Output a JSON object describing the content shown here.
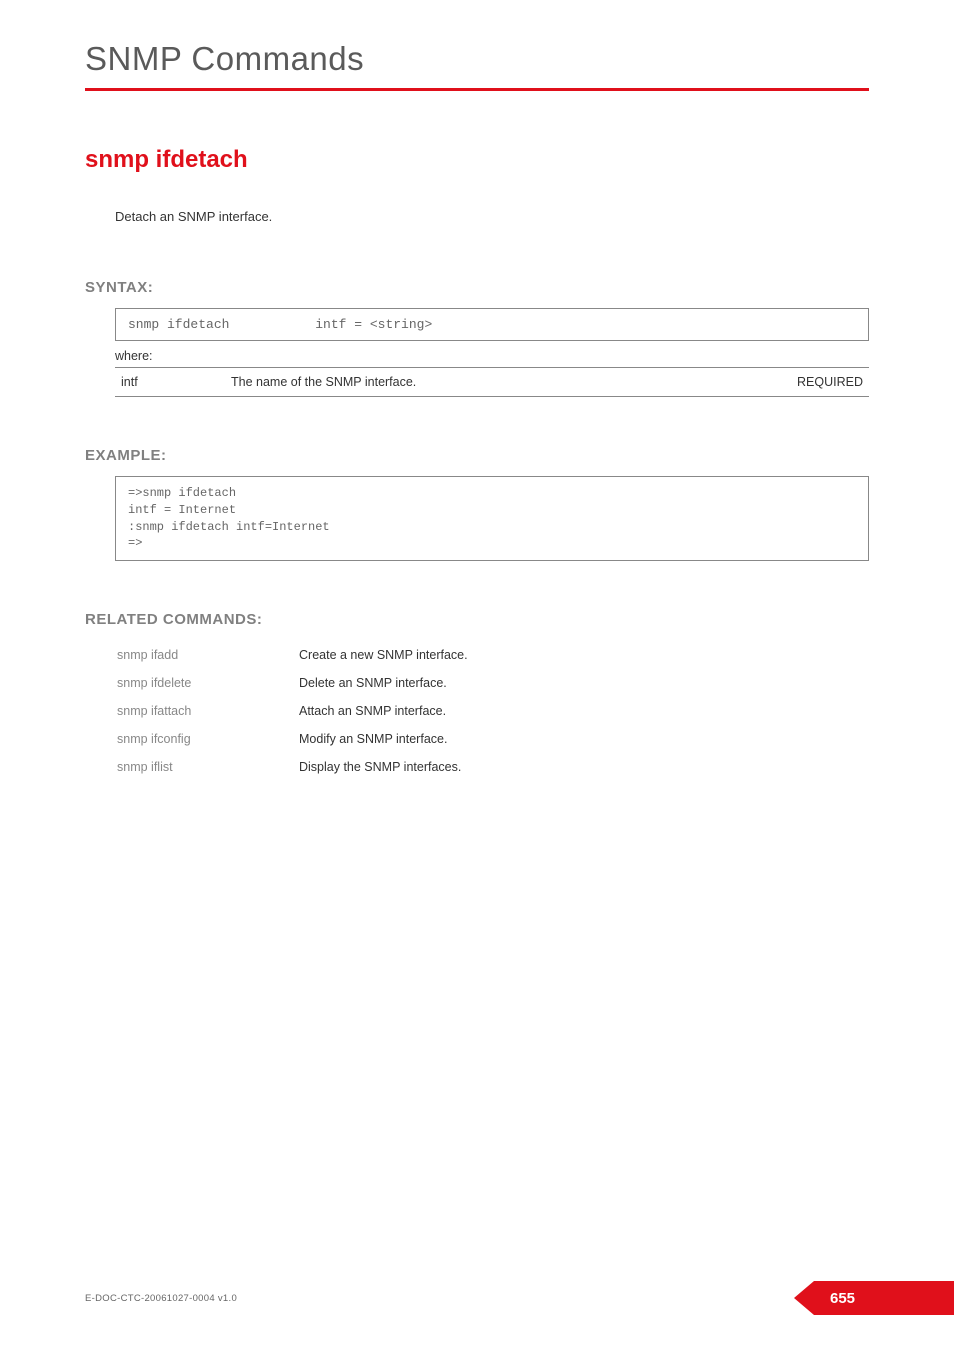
{
  "chapter_title": "SNMP Commands",
  "command_title": "snmp ifdetach",
  "description": "Detach an SNMP interface.",
  "syntax": {
    "heading": "SYNTAX:",
    "code": "snmp ifdetach           intf = <string>",
    "where_label": "where:",
    "params": [
      {
        "name": "intf",
        "desc": "The name of the  SNMP interface.",
        "req": "REQUIRED"
      }
    ]
  },
  "example": {
    "heading": "EXAMPLE:",
    "code": "=>snmp ifdetach\nintf = Internet\n:snmp ifdetach intf=Internet\n=>"
  },
  "related": {
    "heading": "RELATED COMMANDS:",
    "rows": [
      {
        "cmd": "snmp ifadd",
        "desc": "Create a new SNMP interface."
      },
      {
        "cmd": "snmp ifdelete",
        "desc": "Delete an SNMP interface."
      },
      {
        "cmd": "snmp ifattach",
        "desc": "Attach an SNMP interface."
      },
      {
        "cmd": "snmp ifconfig",
        "desc": "Modify an SNMP interface."
      },
      {
        "cmd": "snmp iflist",
        "desc": "Display the SNMP interfaces."
      }
    ]
  },
  "footer": {
    "doc_id": "E-DOC-CTC-20061027-0004 v1.0",
    "page_number": "655"
  }
}
